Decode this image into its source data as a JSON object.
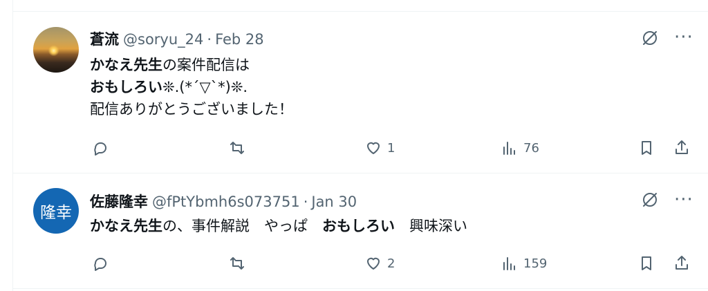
{
  "tweets": [
    {
      "avatar": "sunset-photo",
      "name": "蒼流",
      "handle": "@soryu_24",
      "separator": "·",
      "date": "Feb 28",
      "lines": [
        [
          {
            "text": "かなえ先生",
            "bold": true
          },
          {
            "text": "の案件配信は",
            "bold": false
          }
        ],
        [
          {
            "text": "おもしろい",
            "bold": true
          },
          {
            "text": "❊.(*´▽`*)❊.",
            "bold": false
          }
        ],
        [
          {
            "text": "配信ありがとうございました！",
            "bold": false
          }
        ]
      ],
      "likes": "1",
      "views": "76"
    },
    {
      "avatar_text": "隆幸",
      "name": "佐藤隆幸",
      "handle": "@fPtYbmh6s073751",
      "separator": "·",
      "date": "Jan 30",
      "lines": [
        [
          {
            "text": "かなえ先生",
            "bold": true
          },
          {
            "text": "の、事件解説　やっぱ　",
            "bold": false
          },
          {
            "text": "おもしろい",
            "bold": true
          },
          {
            "text": "　興味深い",
            "bold": false
          }
        ]
      ],
      "likes": "2",
      "views": "159"
    }
  ],
  "icons": {
    "reply": "reply-icon",
    "repost": "repost-icon",
    "like": "heart-icon",
    "views": "views-icon",
    "bookmark": "bookmark-icon",
    "share": "share-icon",
    "grok": "grok-icon",
    "more": "more-icon"
  },
  "more_label": "···",
  "colors": {
    "secondary_text": "#536471",
    "divider": "#eff3f4",
    "avatar_blue": "#1467b3"
  }
}
